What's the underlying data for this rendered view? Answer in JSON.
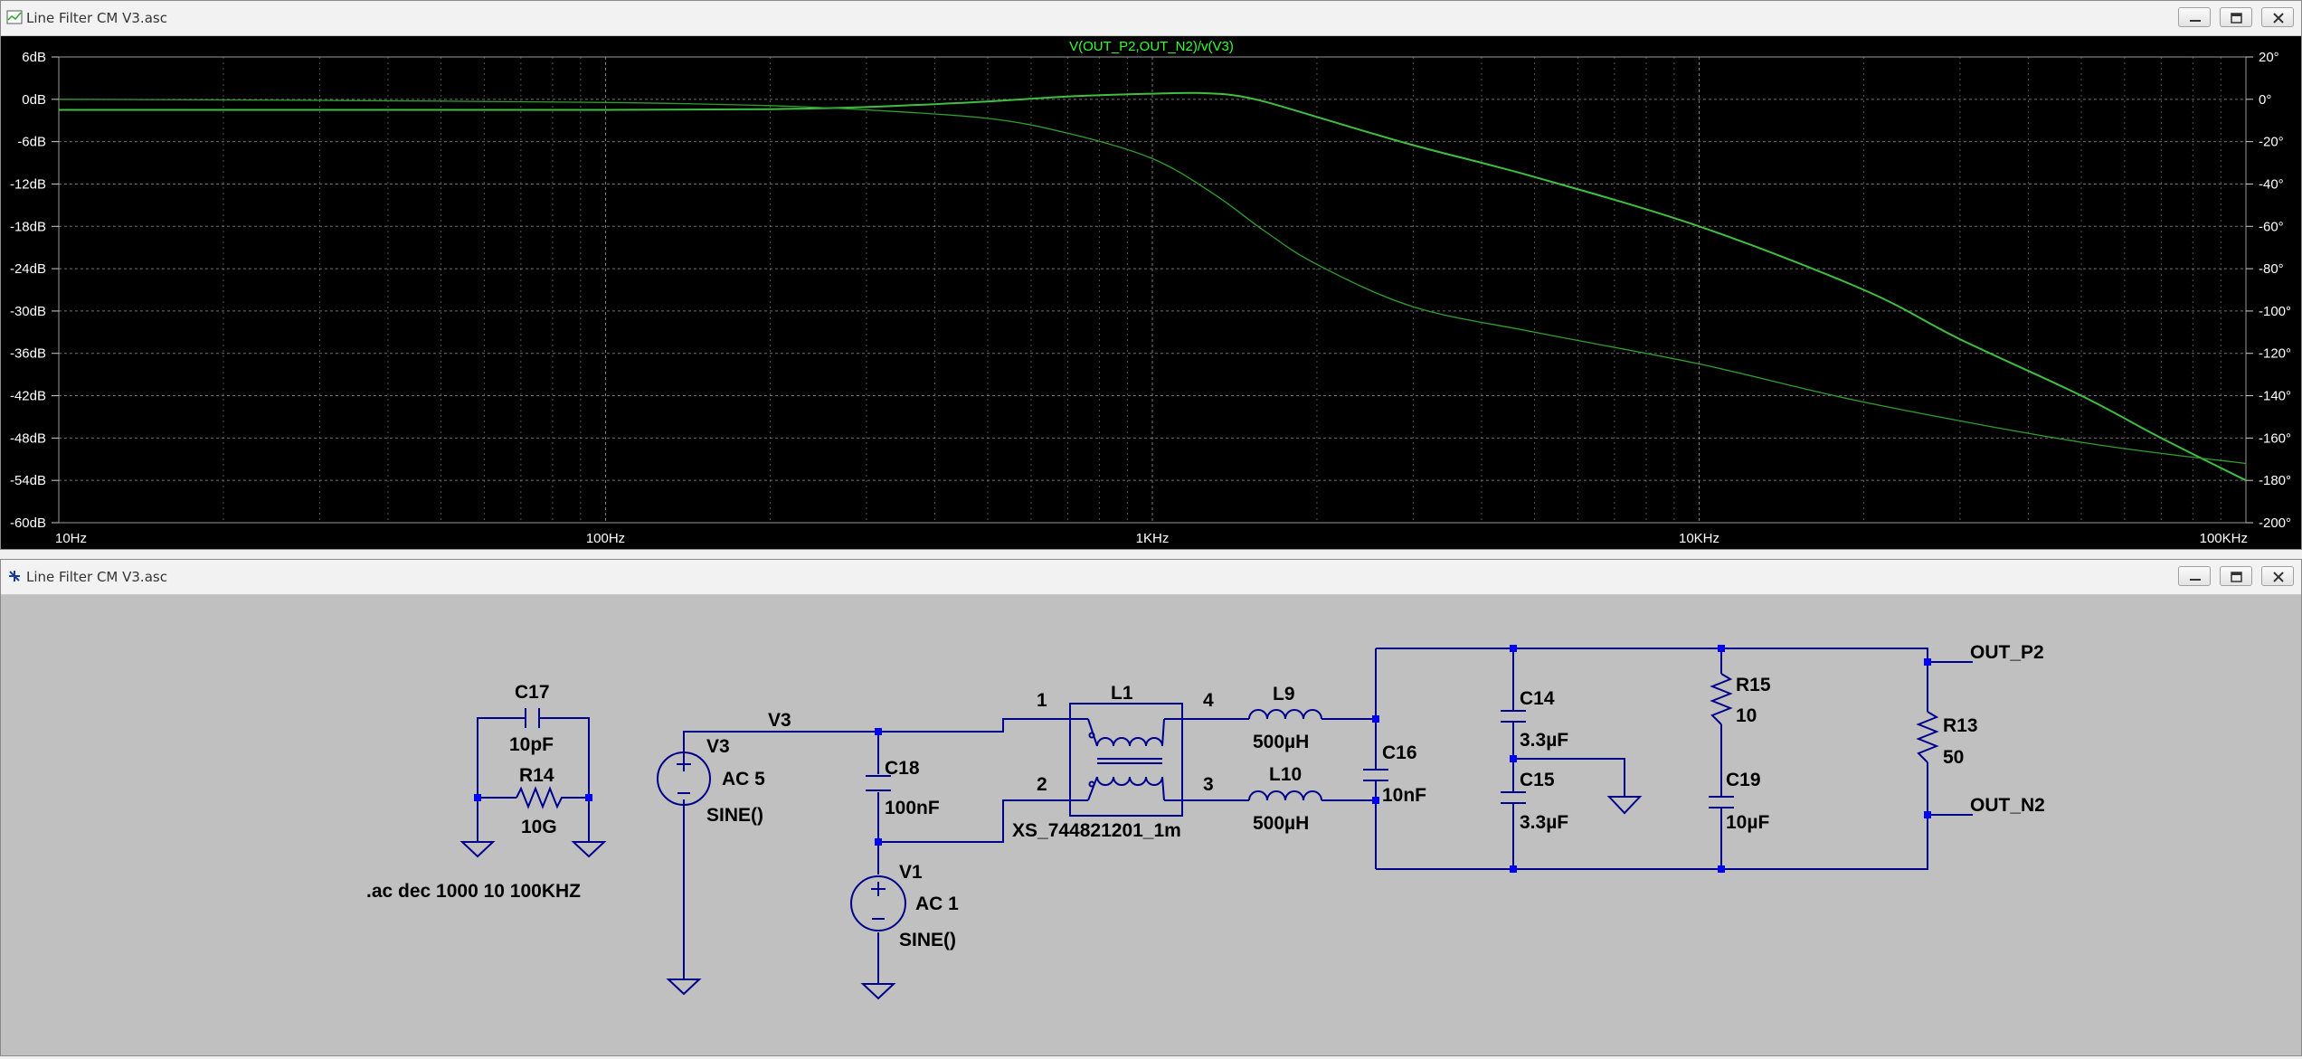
{
  "plot_window": {
    "title": "Line Filter CM V3.asc",
    "trace_label": "V(OUT_P2,OUT_N2)/v(V3)"
  },
  "schematic_window": {
    "title": "Line Filter CM V3.asc"
  },
  "chart_data": {
    "type": "line",
    "title": "V(OUT_P2,OUT_N2)/v(V3)",
    "xscale": "log",
    "xlim": [
      10,
      100000
    ],
    "ylim_left": [
      -60,
      6
    ],
    "ylim_right": [
      -200,
      20
    ],
    "x_tick_labels": [
      "10Hz",
      "100Hz",
      "1KHz",
      "10KHz",
      "100KHz"
    ],
    "y_left_tick_labels": [
      "6dB",
      "0dB",
      "-6dB",
      "-12dB",
      "-18dB",
      "-24dB",
      "-30dB",
      "-36dB",
      "-42dB",
      "-48dB",
      "-54dB",
      "-60dB"
    ],
    "y_right_tick_labels": [
      "20°",
      "0°",
      "-20°",
      "-40°",
      "-60°",
      "-80°",
      "-100°",
      "-120°",
      "-140°",
      "-160°",
      "-180°",
      "-200°"
    ],
    "grid": true,
    "series": [
      {
        "axis": "left",
        "color": "#3fbf3f",
        "points": [
          [
            10,
            -1.5
          ],
          [
            30,
            -1.5
          ],
          [
            100,
            -1.5
          ],
          [
            200,
            -1.4
          ],
          [
            300,
            -1.1
          ],
          [
            500,
            -0.3
          ],
          [
            700,
            0.4
          ],
          [
            1000,
            0.8
          ],
          [
            1200,
            0.9
          ],
          [
            1400,
            0.6
          ],
          [
            1600,
            -0.3
          ],
          [
            2000,
            -2.5
          ],
          [
            3000,
            -6.5
          ],
          [
            5000,
            -11
          ],
          [
            10000,
            -18
          ],
          [
            20000,
            -27
          ],
          [
            30000,
            -34
          ],
          [
            50000,
            -42
          ],
          [
            70000,
            -48
          ],
          [
            100000,
            -54
          ]
        ]
      },
      {
        "axis": "right",
        "color": "#2f9f2f",
        "points": [
          [
            10,
            0
          ],
          [
            30,
            -0.5
          ],
          [
            100,
            -1.5
          ],
          [
            200,
            -3
          ],
          [
            300,
            -5
          ],
          [
            500,
            -9
          ],
          [
            700,
            -16
          ],
          [
            1000,
            -28
          ],
          [
            1300,
            -45
          ],
          [
            1600,
            -62
          ],
          [
            2000,
            -78
          ],
          [
            3000,
            -98
          ],
          [
            5000,
            -110
          ],
          [
            10000,
            -125
          ],
          [
            20000,
            -143
          ],
          [
            50000,
            -162
          ],
          [
            100000,
            -172
          ]
        ]
      }
    ]
  },
  "schematic": {
    "components": {
      "C17": {
        "name": "C17",
        "value": "10pF"
      },
      "R14": {
        "name": "R14",
        "value": "10G"
      },
      "V3": {
        "name": "V3",
        "ac": "AC 5",
        "fn": "SINE()"
      },
      "C18": {
        "name": "C18",
        "value": "100nF"
      },
      "V1": {
        "name": "V1",
        "ac": "AC 1",
        "fn": "SINE()"
      },
      "L1": {
        "name": "L1",
        "model": "XS_744821201_1m",
        "pin1": "1",
        "pin2": "2",
        "pin3": "3",
        "pin4": "4"
      },
      "L9": {
        "name": "L9",
        "value": "500µH"
      },
      "L10": {
        "name": "L10",
        "value": "500µH"
      },
      "C16": {
        "name": "C16",
        "value": "10nF"
      },
      "C14": {
        "name": "C14",
        "value": "3.3µF"
      },
      "C15": {
        "name": "C15",
        "value": "3.3µF"
      },
      "R15": {
        "name": "R15",
        "value": "10"
      },
      "C19": {
        "name": "C19",
        "value": "10µF"
      },
      "R13": {
        "name": "R13",
        "value": "50"
      }
    },
    "nets": {
      "v3": "V3",
      "out_p2": "OUT_P2",
      "out_n2": "OUT_N2"
    },
    "directive": ".ac dec 1000 10 100KHZ"
  },
  "colors": {
    "wire": "#00008b",
    "junction": "#0000ff",
    "schematic_bg": "#c0c0c0",
    "plot_bg": "#000000",
    "plot_text": "#ffffff",
    "trace_label": "#33ff33"
  }
}
